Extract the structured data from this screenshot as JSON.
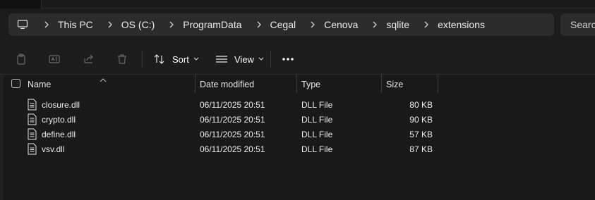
{
  "breadcrumb": {
    "items": [
      {
        "label": "This PC"
      },
      {
        "label": "OS (C:)"
      },
      {
        "label": "ProgramData"
      },
      {
        "label": "Cegal"
      },
      {
        "label": "Cenova"
      },
      {
        "label": "sqlite"
      },
      {
        "label": "extensions"
      }
    ]
  },
  "search": {
    "placeholder": "Search"
  },
  "toolbar": {
    "sort_label": "Sort",
    "view_label": "View"
  },
  "columns": {
    "name": "Name",
    "date_modified": "Date modified",
    "type": "Type",
    "size": "Size"
  },
  "files": [
    {
      "name": "closure.dll",
      "date": "06/11/2025 20:51",
      "type": "DLL File",
      "size": "80 KB"
    },
    {
      "name": "crypto.dll",
      "date": "06/11/2025 20:51",
      "type": "DLL File",
      "size": "90 KB"
    },
    {
      "name": "define.dll",
      "date": "06/11/2025 20:51",
      "type": "DLL File",
      "size": "57 KB"
    },
    {
      "name": "vsv.dll",
      "date": "06/11/2025 20:51",
      "type": "DLL File",
      "size": "87 KB"
    }
  ],
  "icons": {
    "pc": "computer-icon",
    "copy": "copy-icon",
    "rename": "rename-icon",
    "share": "share-icon",
    "delete": "delete-icon",
    "sort": "sort-icon",
    "view": "view-icon",
    "more": "more-icon",
    "file": "file-icon"
  }
}
